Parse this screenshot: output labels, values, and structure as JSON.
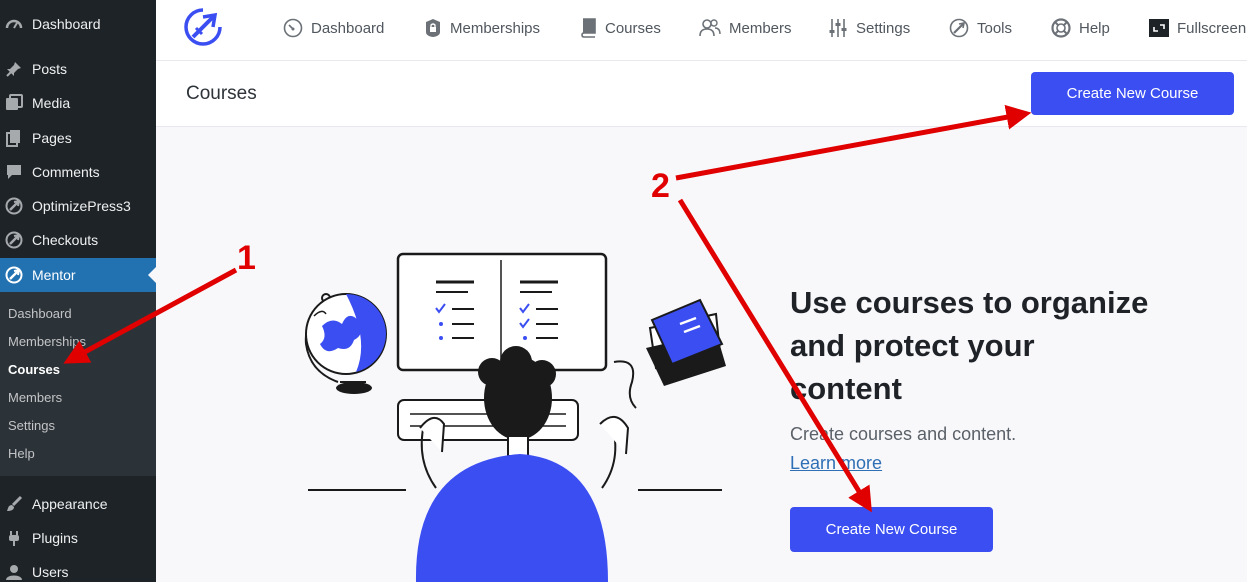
{
  "sidebar": {
    "items": [
      {
        "label": "Dashboard",
        "icon": "dashboard-gauge-icon"
      },
      {
        "label": "Posts",
        "icon": "pushpin-icon"
      },
      {
        "label": "Media",
        "icon": "media-icon"
      },
      {
        "label": "Pages",
        "icon": "pages-icon"
      },
      {
        "label": "Comments",
        "icon": "comment-bubble-icon"
      },
      {
        "label": "OptimizePress3",
        "icon": "optimizepress-rocket-icon"
      },
      {
        "label": "Checkouts",
        "icon": "optimizepress-rocket-icon"
      },
      {
        "label": "Mentor",
        "icon": "optimizepress-rocket-icon",
        "active": true
      }
    ],
    "submenu": [
      {
        "label": "Dashboard"
      },
      {
        "label": "Memberships"
      },
      {
        "label": "Courses",
        "current": true
      },
      {
        "label": "Members"
      },
      {
        "label": "Settings"
      },
      {
        "label": "Help"
      }
    ],
    "items_after": [
      {
        "label": "Appearance",
        "icon": "paintbrush-icon"
      },
      {
        "label": "Plugins",
        "icon": "plug-icon"
      },
      {
        "label": "Users",
        "icon": "user-icon"
      }
    ],
    "active_color": "#2271b1"
  },
  "topnav": {
    "logo": "optimizepress-rocket-logo",
    "items": [
      {
        "label": "Dashboard",
        "icon": "speedometer-icon"
      },
      {
        "label": "Memberships",
        "icon": "lock-icon"
      },
      {
        "label": "Courses",
        "icon": "book-icon"
      },
      {
        "label": "Members",
        "icon": "users-icon"
      },
      {
        "label": "Settings",
        "icon": "sliders-icon"
      },
      {
        "label": "Tools",
        "icon": "rocket-icon"
      },
      {
        "label": "Help",
        "icon": "lifebuoy-icon"
      },
      {
        "label": "Fullscreen",
        "icon": "fullscreen-icon"
      }
    ]
  },
  "header": {
    "title": "Courses",
    "create_button": "Create New Course"
  },
  "empty_state": {
    "heading": "Use courses to organize and protect your content",
    "description": "Create courses and content.",
    "link": "Learn more",
    "create_button": "Create New Course"
  },
  "annotations": {
    "marker_1": "1",
    "marker_2": "2",
    "color": "#e00000"
  },
  "colors": {
    "accent": "#3b4ef2",
    "sidebar_bg": "#1d2327",
    "submenu_bg": "#2c3338"
  }
}
